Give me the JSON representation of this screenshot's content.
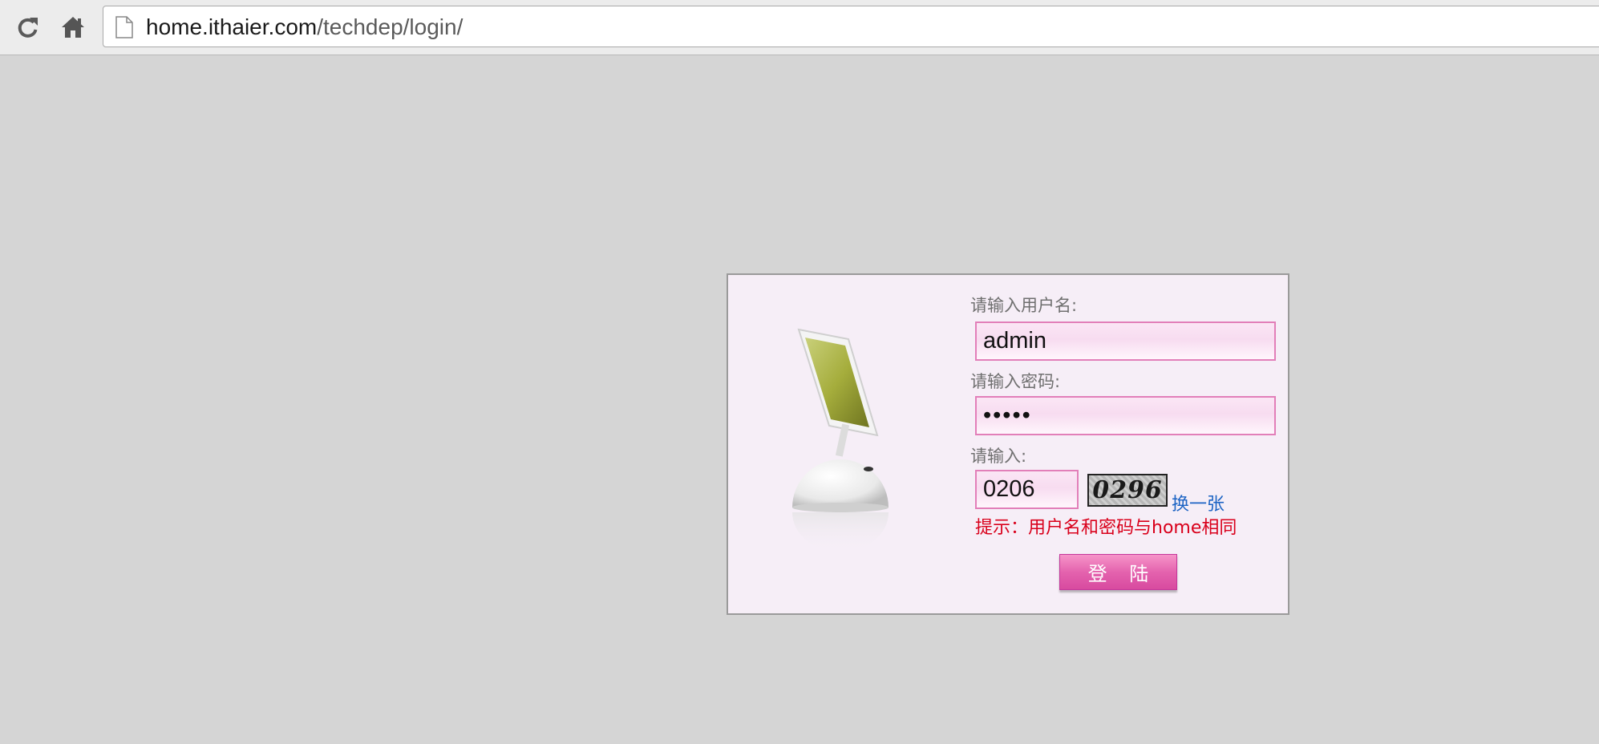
{
  "browser": {
    "url_host": "home.ithaier.com",
    "url_path": "/techdep/login/",
    "reload_icon": "reload-icon",
    "home_icon": "home-icon",
    "page_icon": "document-icon"
  },
  "login": {
    "username_label": "请输入用户名:",
    "username_value": "admin",
    "password_label": "请输入密码:",
    "password_value": "•••••",
    "captcha_label": "请输入:",
    "captcha_value": "0206",
    "captcha_image_text": "0296",
    "refresh_link": "换一张",
    "hint": "提示：用户名和密码与home相同",
    "login_button": "登 陆"
  },
  "colors": {
    "page_background": "#d5d5d5",
    "panel_background": "#f6eef7",
    "input_border": "#e27fb9",
    "hint_color": "#d9001b",
    "link_color": "#1d64c4",
    "button_pink": "#e463ae"
  }
}
